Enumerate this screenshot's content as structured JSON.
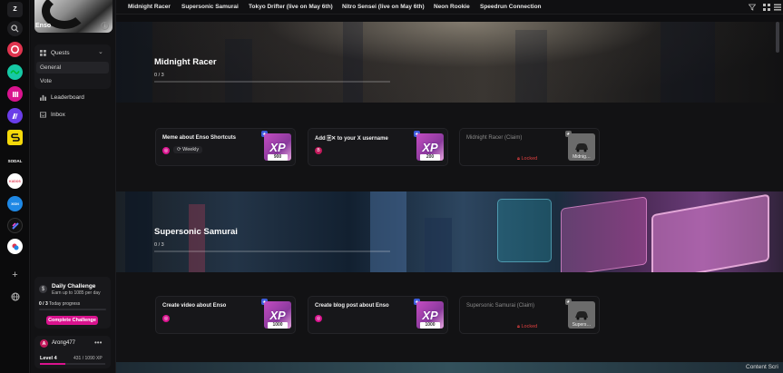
{
  "rail": {
    "top_glyph": "Z",
    "text_items": [
      {
        "name": "sodal-community",
        "text": "SODAL"
      },
      {
        "name": "kudos-community",
        "text": "KUDOS"
      },
      {
        "name": "xion-community",
        "text": "XION"
      }
    ],
    "add_glyph": "+"
  },
  "community": {
    "name": "Enso",
    "info_glyph": "i",
    "menu": {
      "quests": "Quests",
      "general": "General",
      "vote": "Vote",
      "leaderboard": "Leaderboard",
      "inbox": "Inbox"
    }
  },
  "daily": {
    "title": "Daily Challenge",
    "subtitle": "Earn up to 1085 per day",
    "progress_count": "0 / 3",
    "progress_label": "Today progress",
    "progress": 0,
    "button": "Complete Challenge"
  },
  "user": {
    "initial": "A",
    "name": "Arong477",
    "menu_glyph": "•••",
    "level": "Level 4",
    "xp": "431 / 1090 XP",
    "xp_fraction": 0.395
  },
  "tabs": [
    "Midnight Racer",
    "Supersonic Samurai",
    "Tokyo Drifter (live on May 6th)",
    "Nitro Sensei (live on May 6th)",
    "Neon Rookie",
    "Speedrun Connection"
  ],
  "quest_groups": [
    {
      "title": "Midnight Racer",
      "count": "0 / 3",
      "cards": [
        {
          "title": "Meme about Enso Shortcuts",
          "tag": "Weekly",
          "xp_label": "XP",
          "points": "900",
          "locked": false
        },
        {
          "title": "Add 🀄︎✕ to your X username",
          "tag": "",
          "xp_label": "XP",
          "points": "200",
          "locked": false
        },
        {
          "title": "Midnight Racer (Claim)",
          "locked": true,
          "lock_text": "Locked",
          "thumb_label": "Midnig…"
        }
      ]
    },
    {
      "title": "Supersonic Samurai",
      "count": "0 / 3",
      "cards": [
        {
          "title": "Create video about Enso",
          "tag": "",
          "xp_label": "XP",
          "points": "1000",
          "locked": false
        },
        {
          "title": "Create blog post about Enso",
          "tag": "",
          "xp_label": "XP",
          "points": "1000",
          "locked": false
        },
        {
          "title": "Supersonic Samurai (Claim)",
          "locked": true,
          "lock_text": "Locked",
          "thumb_label": "Supers…"
        }
      ]
    }
  ],
  "footer_text": "Content Scri",
  "colors": {
    "accent": "#d9138e",
    "locked": "#e04040",
    "badge": "#3b5bdb",
    "bg": "#0e0e10"
  }
}
